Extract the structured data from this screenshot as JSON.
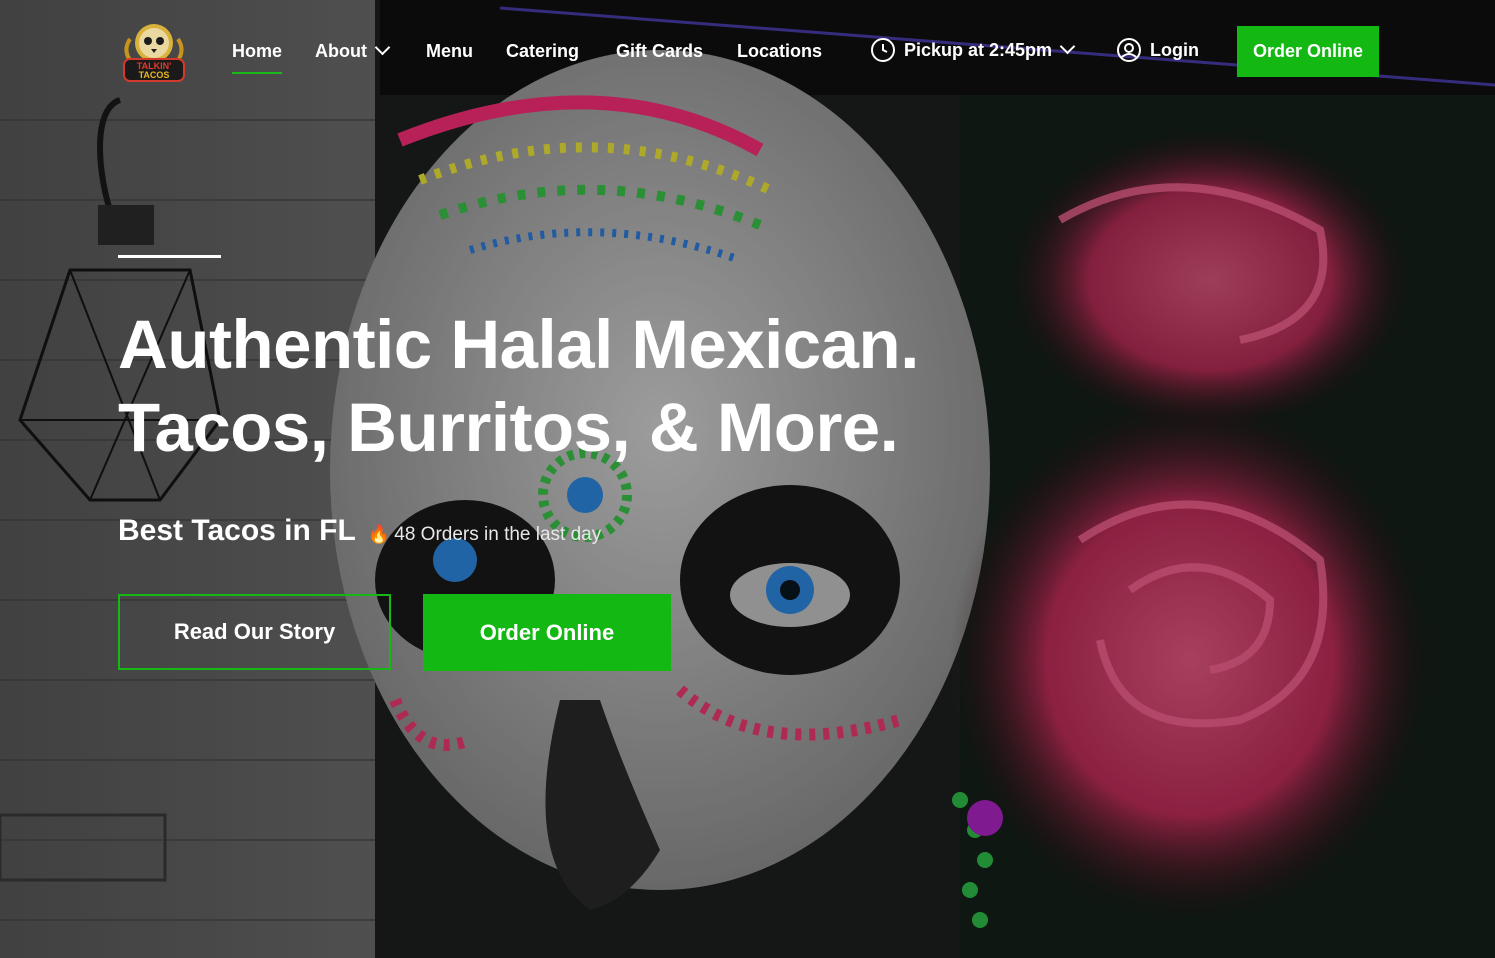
{
  "brand": {
    "logo_alt": "Talkin' Tacos",
    "logo_text_line1": "TALKIN'",
    "logo_text_line2": "TACOS"
  },
  "nav": {
    "items": [
      {
        "label": "Home",
        "active": true
      },
      {
        "label": "About",
        "has_dropdown": true
      },
      {
        "label": "Menu"
      },
      {
        "label": "Catering"
      },
      {
        "label": "Gift Cards"
      },
      {
        "label": "Locations"
      }
    ],
    "pickup_label": "Pickup at 2:45pm",
    "login_label": "Login",
    "order_button": "Order Online"
  },
  "hero": {
    "headline_line1": "Authentic Halal Mexican.",
    "headline_line2": "Tacos, Burritos, & More.",
    "tagline": "Best Tacos in FL",
    "orders_text": "48 Orders in the last day",
    "story_button": "Read Our Story",
    "order_button": "Order Online"
  },
  "colors": {
    "accent_green": "#13b813",
    "text": "#ffffff"
  },
  "icons": [
    "chevron-down-icon",
    "clock-icon",
    "user-circle-icon",
    "fire-icon"
  ]
}
